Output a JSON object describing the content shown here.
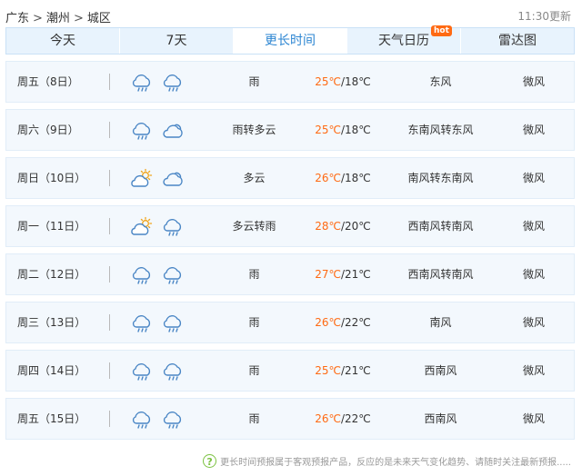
{
  "breadcrumb": {
    "province": "广东",
    "sep": ">",
    "city": "潮州",
    "district": "城区"
  },
  "updated": "11:30更新",
  "tabs": [
    {
      "label": "今天"
    },
    {
      "label": "7天"
    },
    {
      "label": "更长时间",
      "active": true
    },
    {
      "label": "天气日历",
      "badge": "hot"
    },
    {
      "label": "雷达图"
    }
  ],
  "colors": {
    "accent": "#2d86d2",
    "temp_high": "#ff6a13",
    "tab_bg": "#e8f3fd",
    "row_bg": "#f3f8fd",
    "icon": "#4a86c5",
    "sun": "#f1a318"
  },
  "forecast": [
    {
      "day": "周五（8日）",
      "icons": [
        "rain-icon",
        "rain-icon"
      ],
      "desc": "雨",
      "high": "25℃",
      "low": "18℃",
      "wind": "东风",
      "level": "微风"
    },
    {
      "day": "周六（9日）",
      "icons": [
        "rain-icon",
        "cloudy-icon"
      ],
      "desc": "雨转多云",
      "high": "25℃",
      "low": "18℃",
      "wind": "东南风转东风",
      "level": "微风"
    },
    {
      "day": "周日（10日）",
      "icons": [
        "partly-cloudy-icon",
        "cloudy-icon"
      ],
      "desc": "多云",
      "high": "26℃",
      "low": "18℃",
      "wind": "南风转东南风",
      "level": "微风"
    },
    {
      "day": "周一（11日）",
      "icons": [
        "partly-cloudy-icon",
        "rain-icon"
      ],
      "desc": "多云转雨",
      "high": "28℃",
      "low": "20℃",
      "wind": "西南风转南风",
      "level": "微风"
    },
    {
      "day": "周二（12日）",
      "icons": [
        "rain-icon",
        "rain-icon"
      ],
      "desc": "雨",
      "high": "27℃",
      "low": "21℃",
      "wind": "西南风转南风",
      "level": "微风"
    },
    {
      "day": "周三（13日）",
      "icons": [
        "rain-icon",
        "rain-icon"
      ],
      "desc": "雨",
      "high": "26℃",
      "low": "22℃",
      "wind": "南风",
      "level": "微风"
    },
    {
      "day": "周四（14日）",
      "icons": [
        "rain-icon",
        "rain-icon"
      ],
      "desc": "雨",
      "high": "25℃",
      "low": "21℃",
      "wind": "西南风",
      "level": "微风"
    },
    {
      "day": "周五（15日）",
      "icons": [
        "rain-icon",
        "rain-icon"
      ],
      "desc": "雨",
      "high": "26℃",
      "low": "22℃",
      "wind": "西南风",
      "level": "微风"
    }
  ],
  "footer": {
    "icon": "question-icon",
    "text": "更长时间预报属于客观预报产品，反应的是未来天气变化趋势、请随时关注最新预报....."
  }
}
